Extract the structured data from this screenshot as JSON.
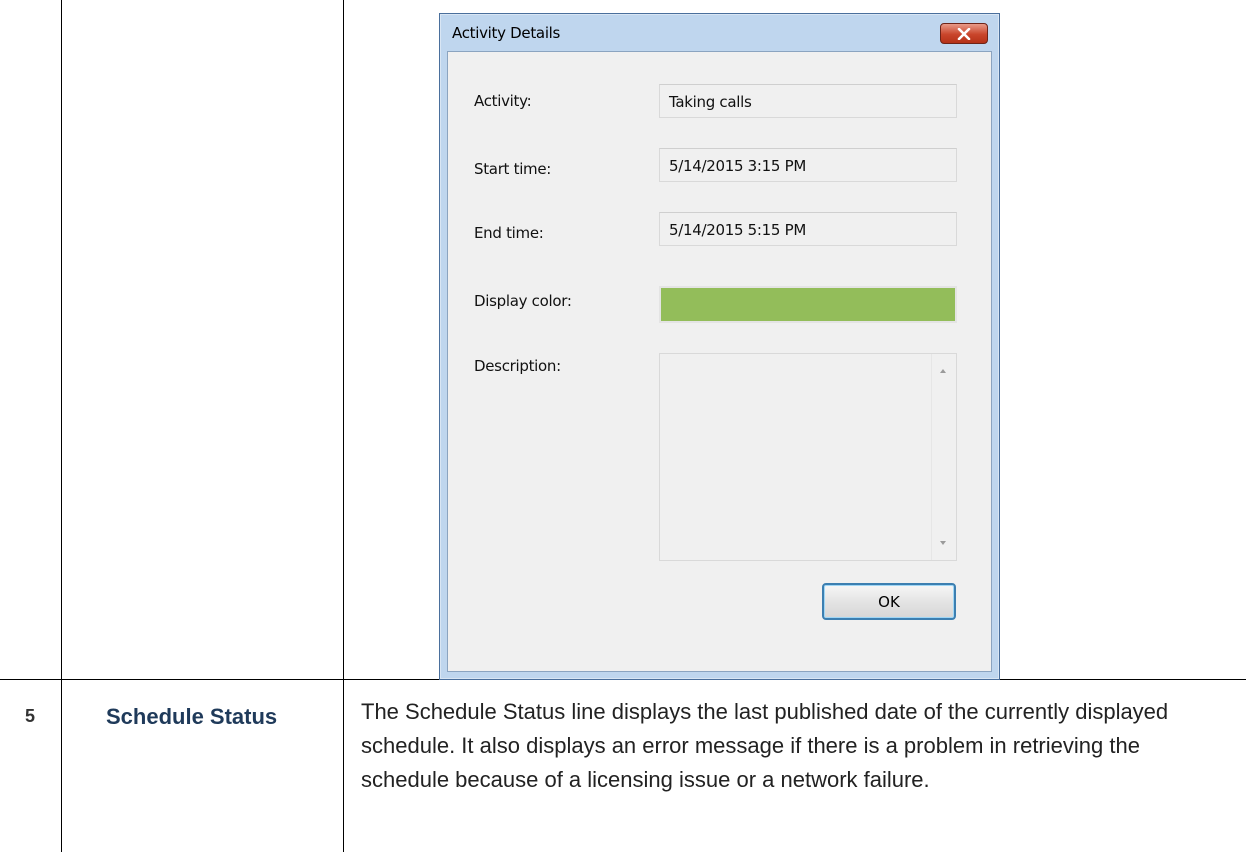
{
  "dialog": {
    "title": "Activity Details",
    "fields": {
      "activity_label": "Activity:",
      "activity_value": "Taking calls",
      "start_label": "Start time:",
      "start_value": "5/14/2015 3:15 PM",
      "end_label": "End time:",
      "end_value": "5/14/2015 5:15 PM",
      "color_label": "Display color:",
      "display_color": "#93bd5a",
      "description_label": "Description:",
      "description_value": ""
    },
    "ok_label": "OK",
    "close_icon": "close-icon"
  },
  "table": {
    "row": {
      "number": "5",
      "title": "Schedule Status",
      "description": "The Schedule Status line displays the last published date of the currently displayed schedule. It also displays an error message if there is a problem in retrieving the schedule because of a licensing issue or a network failure."
    }
  }
}
